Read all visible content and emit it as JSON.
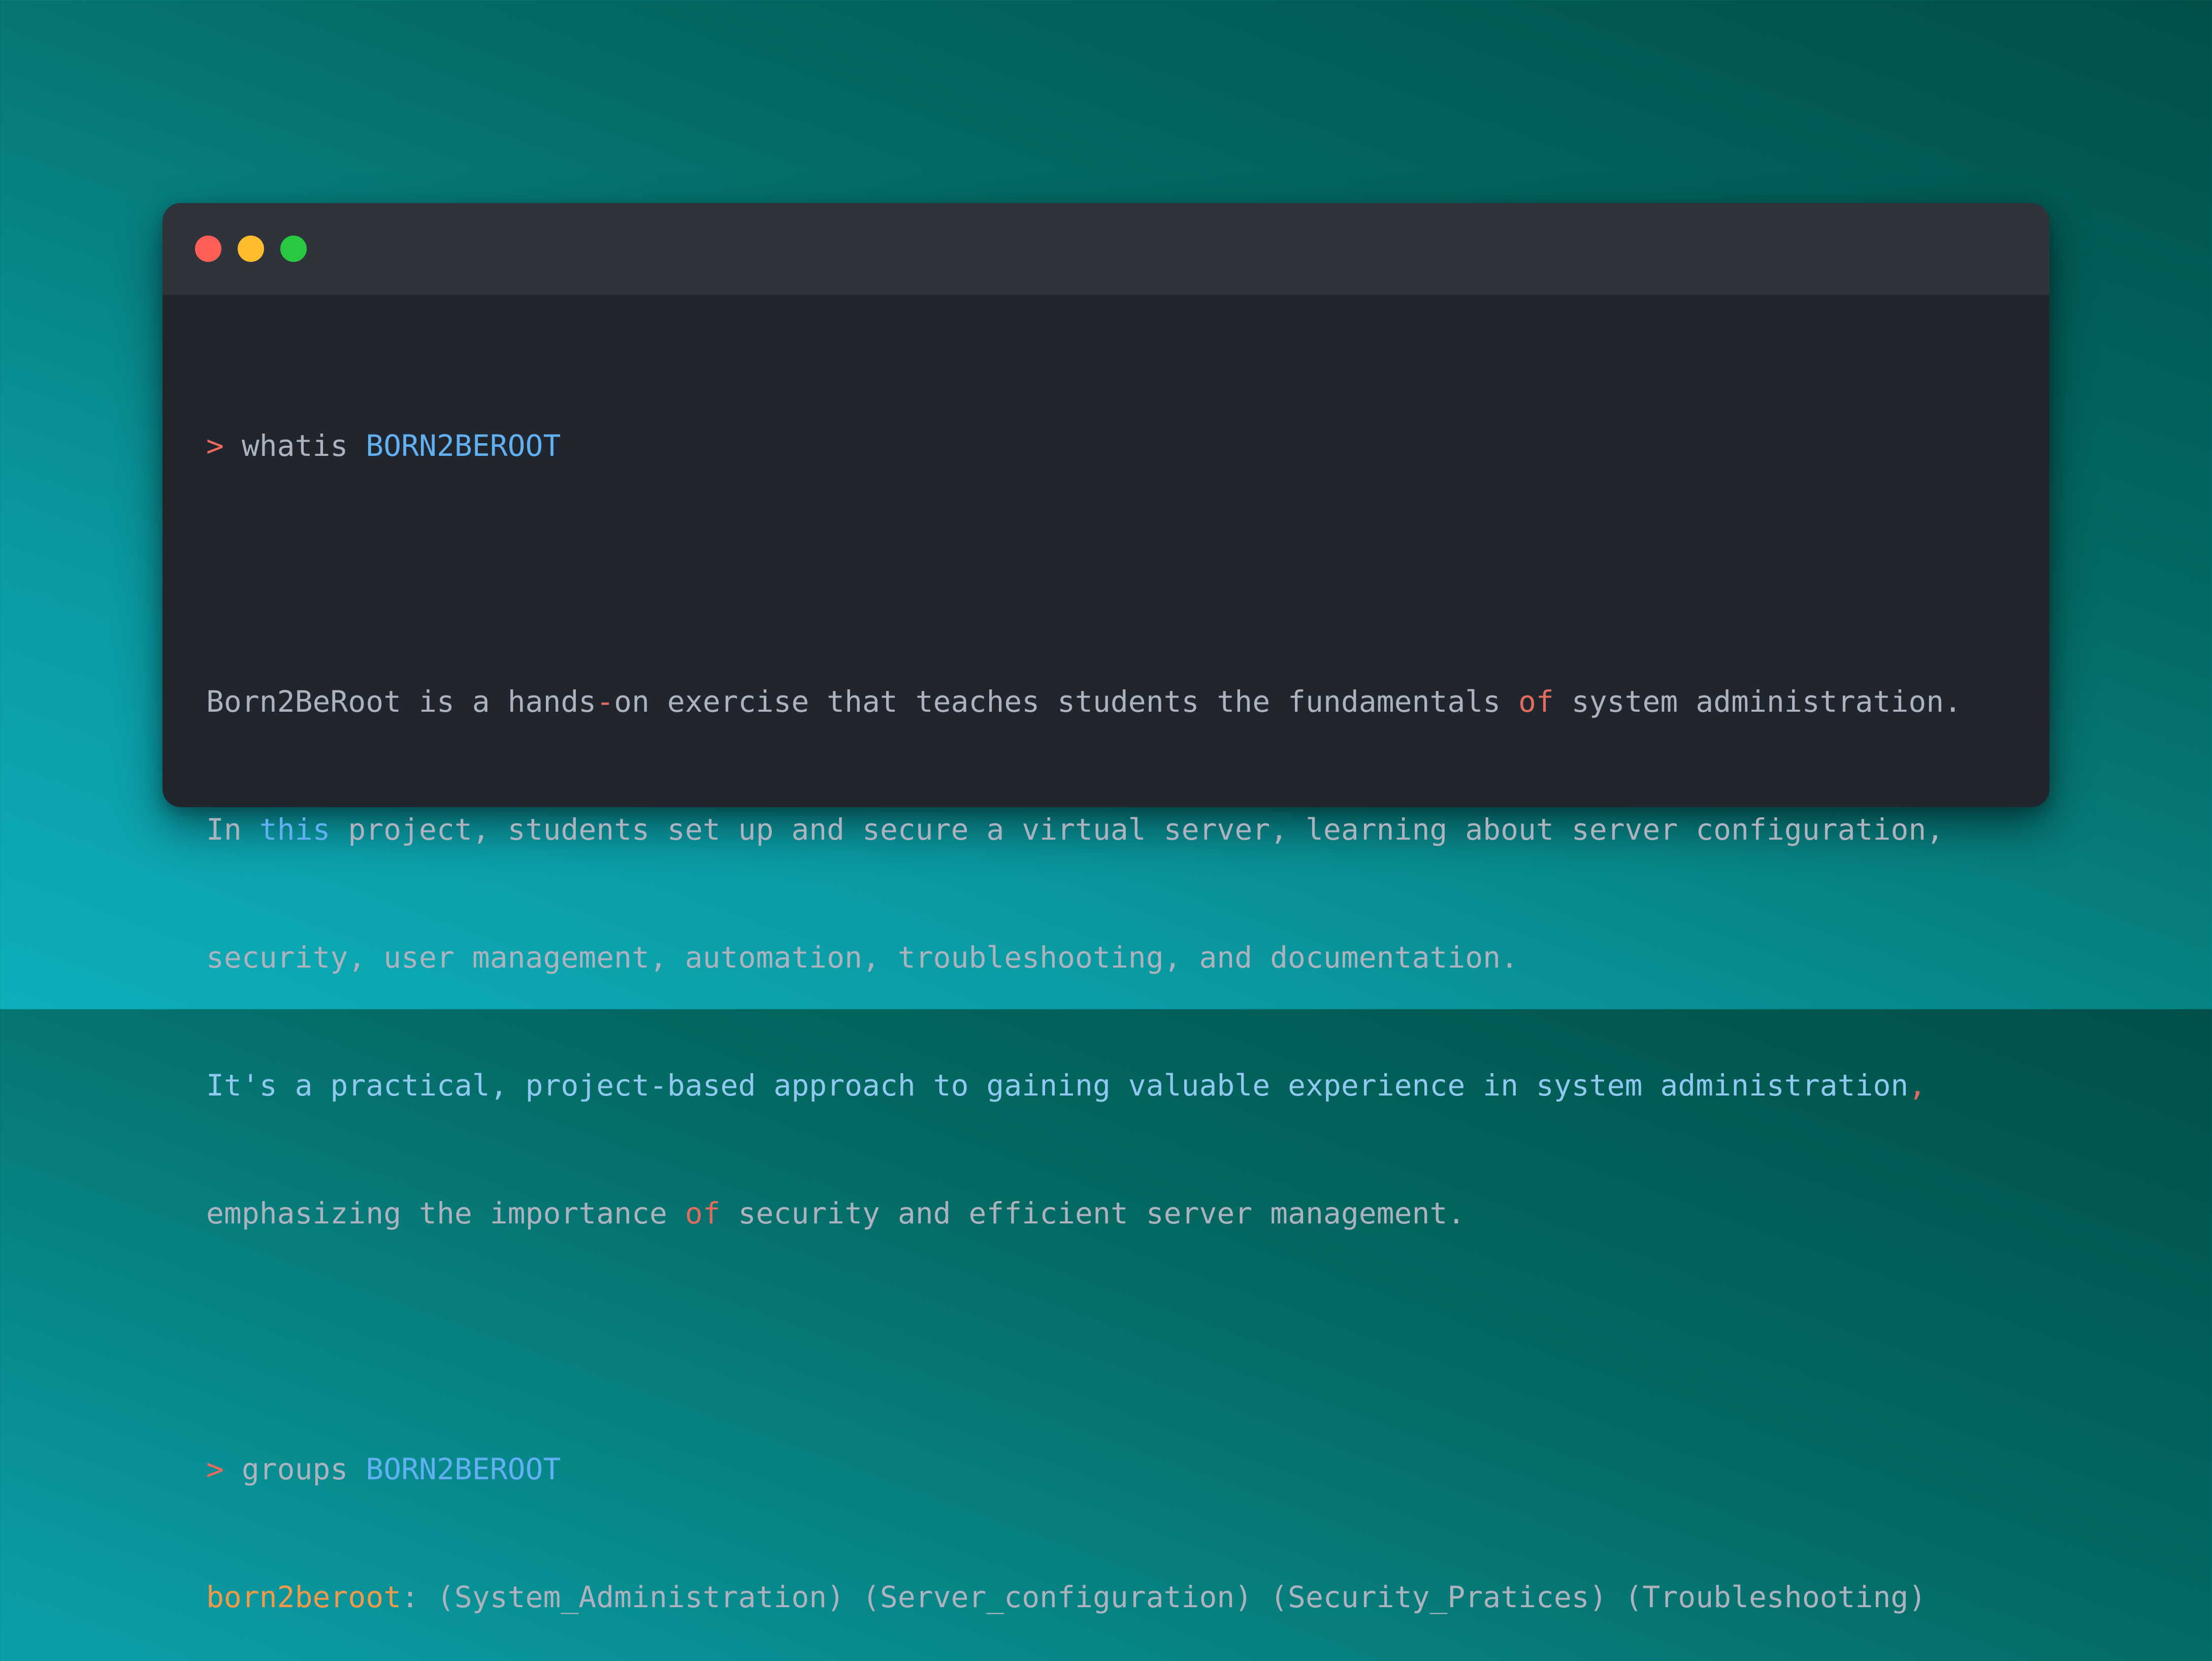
{
  "window": {
    "controls": {
      "close_color": "#ff5f57",
      "minimize_color": "#febc2e",
      "maximize_color": "#28c840"
    }
  },
  "terminal": {
    "command1": {
      "prompt": ">",
      "cmd": " whatis ",
      "arg": "BORN2BEROOT"
    },
    "description": {
      "line1_a": "Born2BeRoot is a hands",
      "line1_dash": "-",
      "line1_b": "on exercise that teaches students the fundamentals ",
      "line1_of": "of",
      "line1_c": " system administration.",
      "line2_a": "In ",
      "line2_this": "this",
      "line2_b": " project, students set up and secure a virtual server, learning about server configuration,",
      "line3": "security, user management, automation, troubleshooting, and documentation.",
      "line4_a": "It's a practical, project-based approach to gaining valuable experience in system administration",
      "line4_comma": ",",
      "line5_a": "emphasizing the importance ",
      "line5_of": "of",
      "line5_b": " security and efficient server management."
    },
    "command2": {
      "prompt": ">",
      "cmd": " groups ",
      "arg": "BORN2BEROOT"
    },
    "groups_output": {
      "name": "born2beroot",
      "rest": ": (System_Administration) (Server_configuration) (Security_Pratices) (Troubleshooting)"
    }
  }
}
